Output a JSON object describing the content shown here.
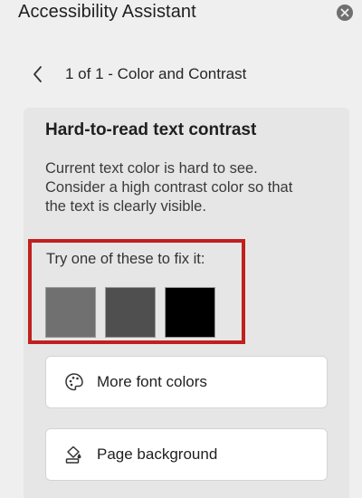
{
  "pane": {
    "title": "Accessibility Assistant",
    "close_icon": "close-circle-icon"
  },
  "navigation": {
    "back_icon": "chevron-left-icon",
    "breadcrumb": "1 of 1 - Color and Contrast"
  },
  "issue": {
    "title": "Hard-to-read text contrast",
    "description": "Current text color is hard to see. Consider a high contrast color so that the text is clearly visible.",
    "fix_prompt": "Try one of these to fix it:",
    "swatches": [
      {
        "color": "#707070"
      },
      {
        "color": "#4f4f4f"
      },
      {
        "color": "#000000"
      }
    ],
    "highlight_color": "#c0201f"
  },
  "actions": [
    {
      "label": "More font colors",
      "icon": "palette-icon"
    },
    {
      "label": "Page background",
      "icon": "paint-bucket-icon"
    }
  ]
}
